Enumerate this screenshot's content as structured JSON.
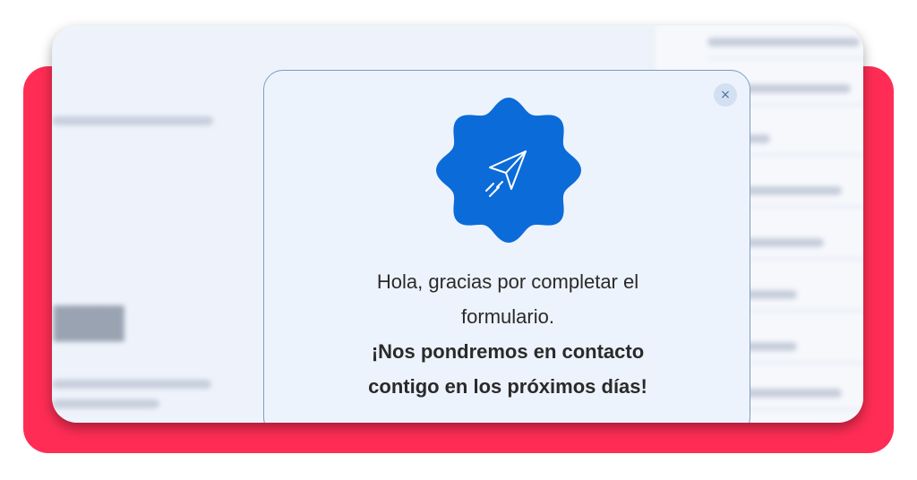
{
  "modal": {
    "close_symbol": "×",
    "close_icon": "close-icon",
    "badge_icon": "paper-plane-icon",
    "message_line_1": "Hola, gracias por completar el",
    "message_line_2": "formulario.",
    "message_bold_1": "¡Nos pondremos en contacto",
    "message_bold_2": "contigo en los próximos días!"
  },
  "colors": {
    "accent": "#ff2d55",
    "badge": "#0b6bd9",
    "modal_bg": "#edf3fc"
  }
}
